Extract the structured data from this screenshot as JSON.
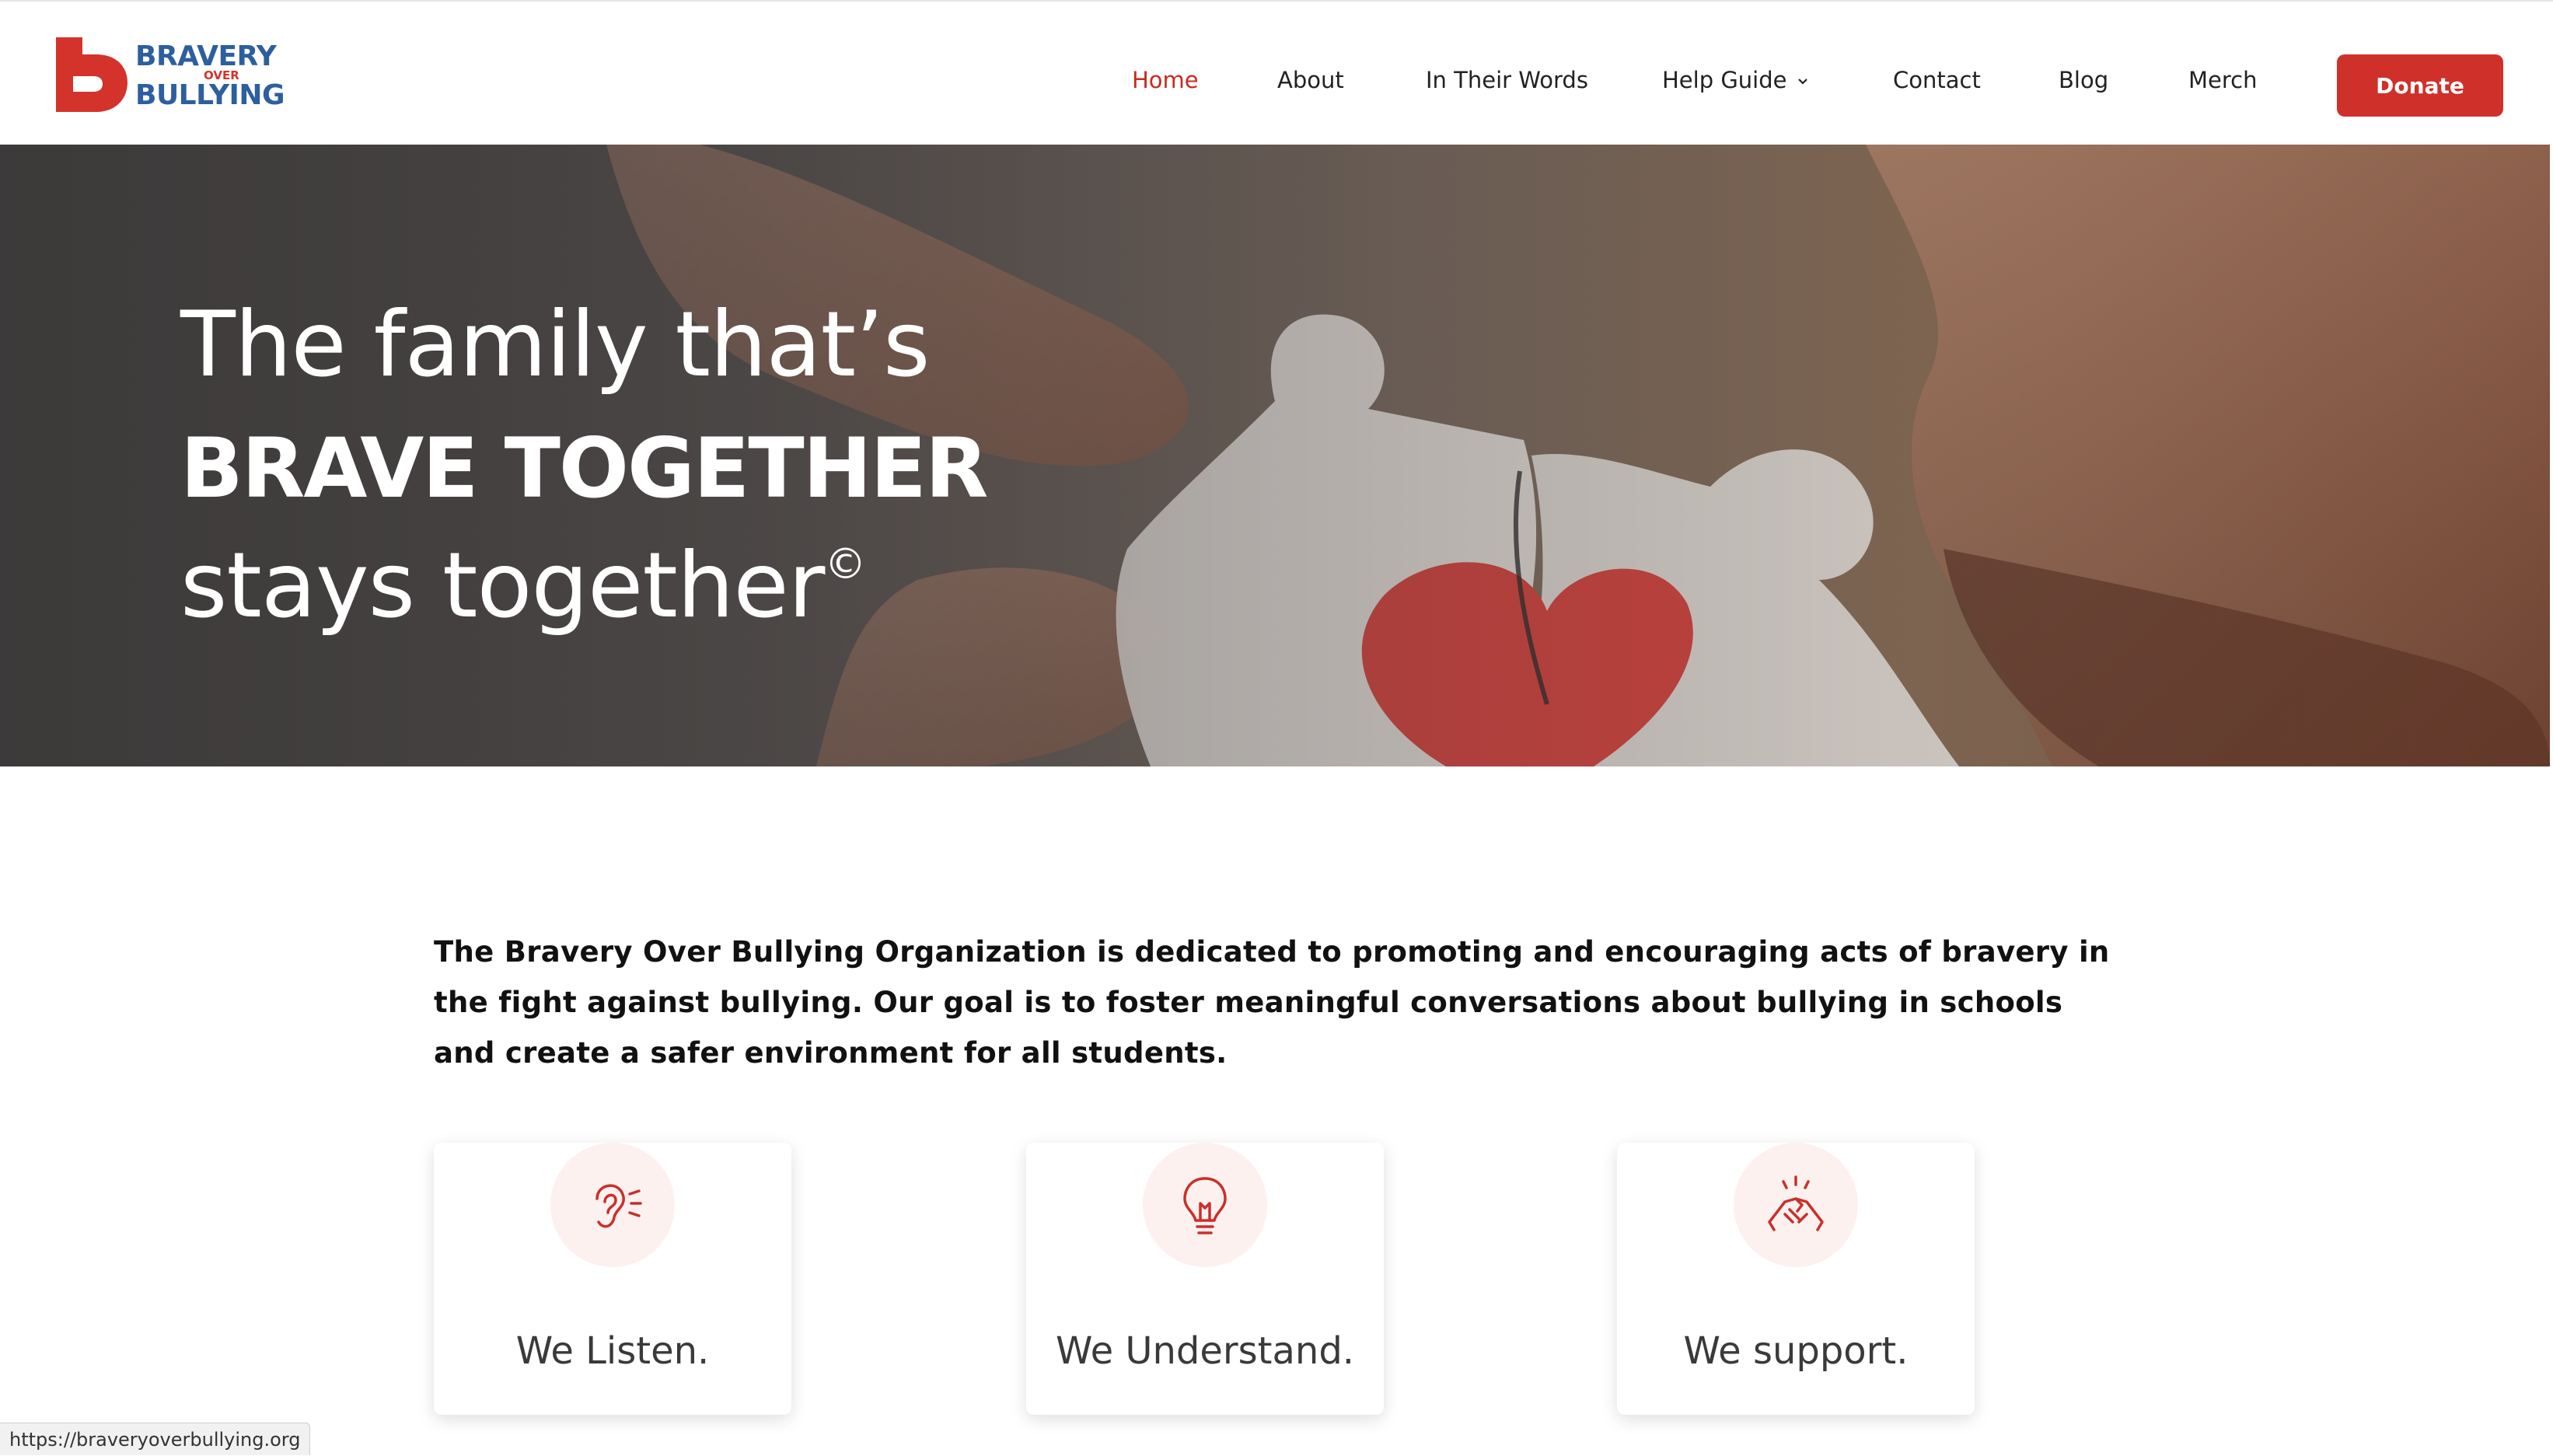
{
  "logo": {
    "line1": "BRAVERY",
    "line2": "OVER",
    "line3": "BULLYING"
  },
  "nav": {
    "items": [
      {
        "label": "Home"
      },
      {
        "label": "About"
      },
      {
        "label": "In Their Words"
      },
      {
        "label": "Help Guide"
      },
      {
        "label": "Contact"
      },
      {
        "label": "Blog"
      },
      {
        "label": "Merch"
      }
    ],
    "active": "Home",
    "donate_label": "Donate"
  },
  "hero": {
    "line1": "The family that’s",
    "line2": "BRAVE TOGETHER",
    "line3": "stays together",
    "copyright": "©"
  },
  "intro": {
    "text": "The Bravery Over Bullying Organization is dedicated to promoting and encouraging acts of bravery in the fight against bullying. Our goal is to foster meaningful conversations about bullying in schools and create a safer environment for all students."
  },
  "cards": [
    {
      "icon": "ear-icon",
      "label": "We Listen."
    },
    {
      "icon": "lightbulb-icon",
      "label": "We Understand."
    },
    {
      "icon": "handshake-icon",
      "label": "We support."
    }
  ],
  "status_url": "https://braveryoverbullying.org",
  "colors": {
    "brand_red": "#d0302a",
    "brand_blue": "#2d5f9e",
    "active_nav": "#c92b21"
  }
}
